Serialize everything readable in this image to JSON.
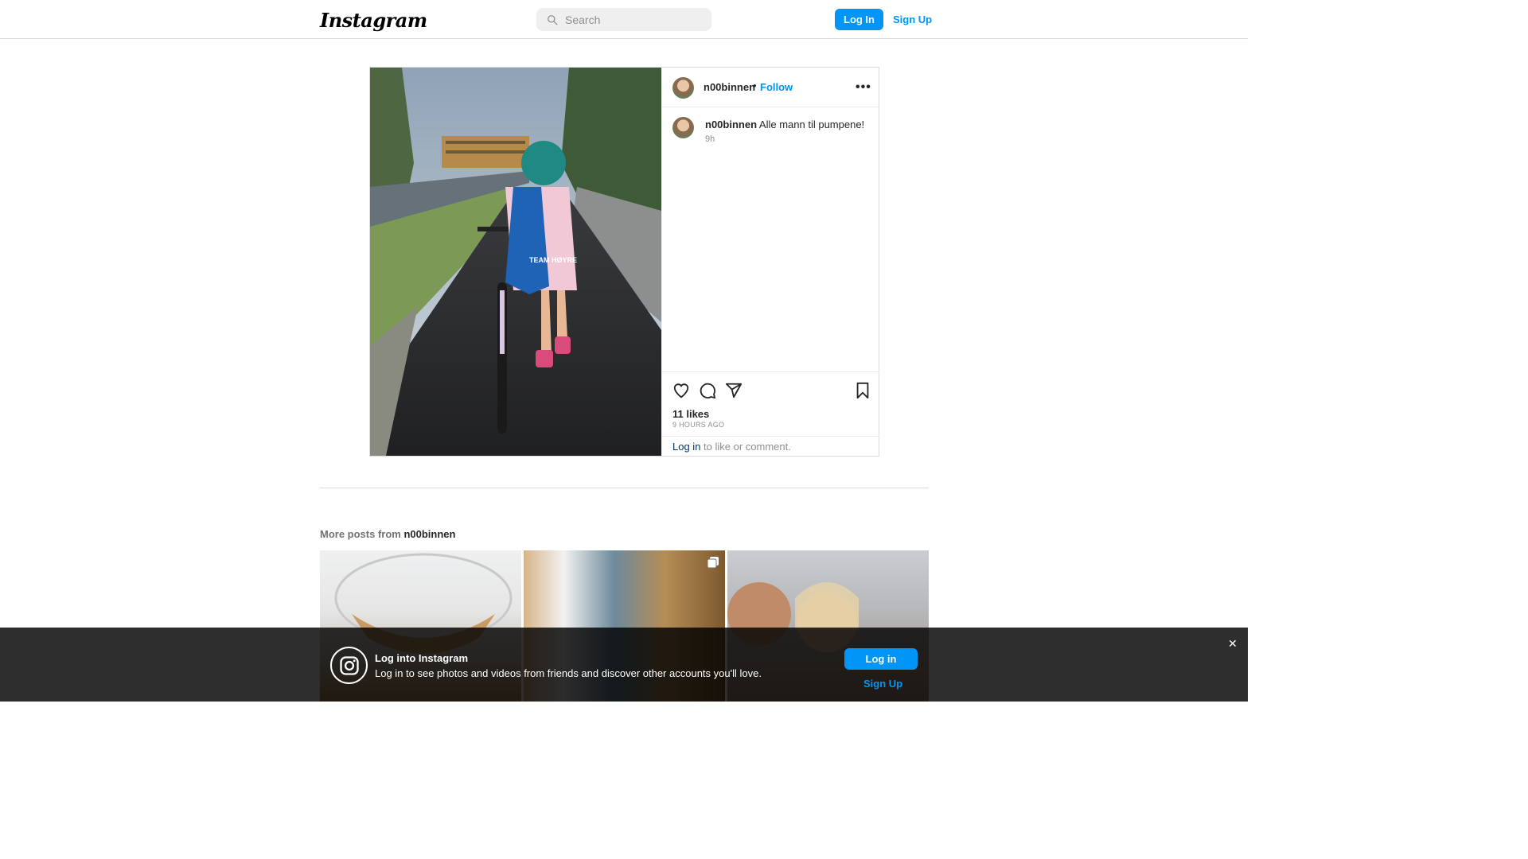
{
  "header": {
    "logo": "Instagram",
    "search_placeholder": "Search",
    "login_label": "Log In",
    "signup_label": "Sign Up"
  },
  "post": {
    "username": "n00binnen",
    "separator": "•",
    "follow_label": "Follow",
    "more_label": "•••",
    "caption_user": "n00binnen",
    "caption_text": "Alle mann til pumpene!",
    "caption_time": "9h",
    "likes": "11 likes",
    "posted_ago": "9 HOURS AGO",
    "login_link": "Log in",
    "login_suffix": " to like or comment.",
    "photo_scarf_text": "TEAM HØYRE"
  },
  "more_posts": {
    "prefix": "More posts from ",
    "username": "n00binnen"
  },
  "banner": {
    "title": "Log into Instagram",
    "text": "Log in to see photos and videos from friends and discover other accounts you'll love.",
    "login_label": "Log in",
    "signup_label": "Sign Up",
    "close_label": "✕"
  },
  "icons": [
    "search-icon",
    "heart-icon",
    "comment-icon",
    "share-icon",
    "bookmark-icon",
    "more-icon",
    "instagram-logo-icon",
    "close-icon",
    "carousel-icon"
  ],
  "colors": {
    "accent": "#0095f6",
    "link": "#00376b",
    "border": "#dbdbdb",
    "muted": "#8e8e8e"
  }
}
